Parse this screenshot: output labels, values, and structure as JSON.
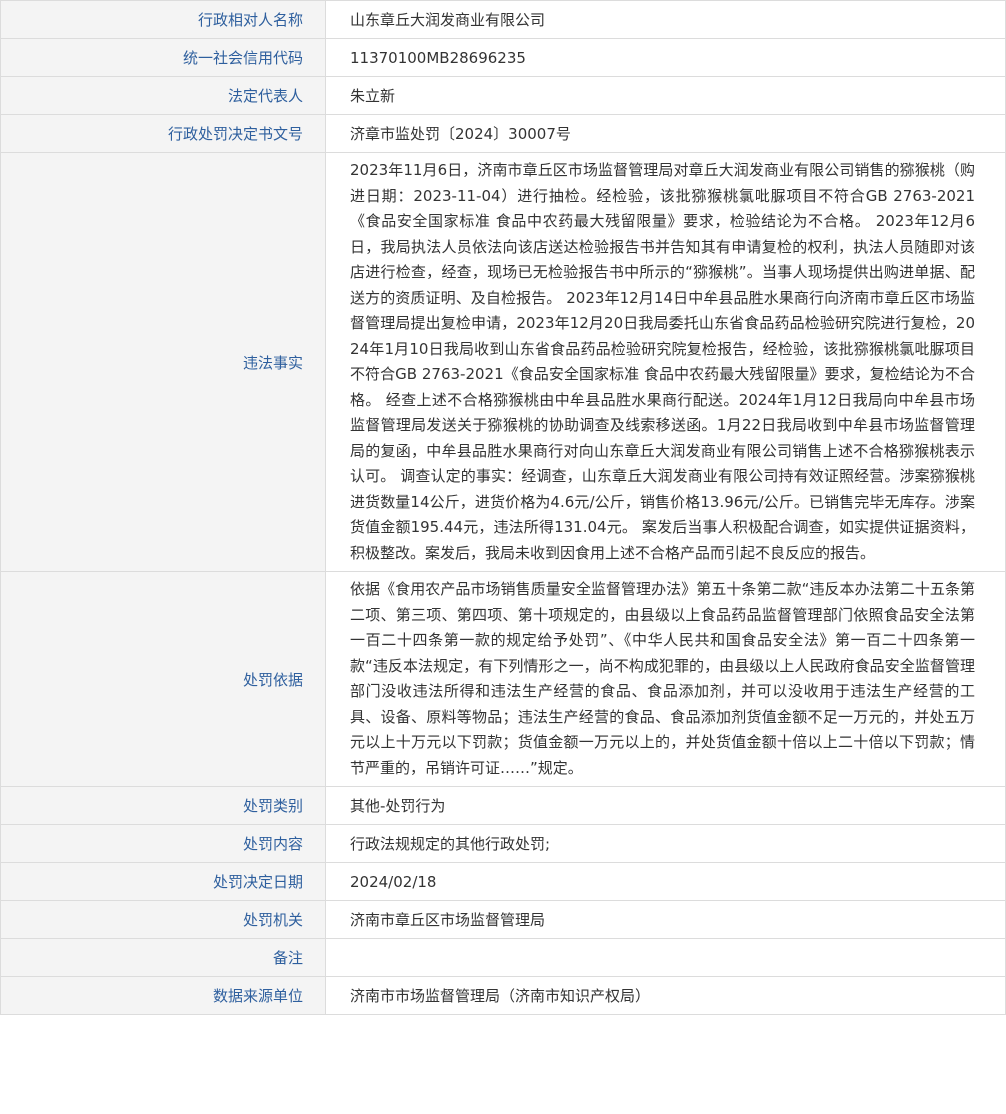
{
  "rows": [
    {
      "label": "行政相对人名称",
      "value": "山东章丘大润发商业有限公司"
    },
    {
      "label": "统一社会信用代码",
      "value": "11370100MB28696235"
    },
    {
      "label": "法定代表人",
      "value": "朱立新"
    },
    {
      "label": "行政处罚决定书文号",
      "value": "济章市监处罚〔2024〕30007号"
    },
    {
      "label": "违法事实",
      "value": "2023年11月6日，济南市章丘区市场监督管理局对章丘大润发商业有限公司销售的猕猴桃（购进日期：2023-11-04）进行抽检。经检验，该批猕猴桃氯吡脲项目不符合GB 2763-2021《食品安全国家标准 食品中农药最大残留限量》要求，检验结论为不合格。 2023年12月6日，我局执法人员依法向该店送达检验报告书并告知其有申请复检的权利，执法人员随即对该店进行检查，经查，现场已无检验报告书中所示的“猕猴桃”。当事人现场提供出购进单据、配送方的资质证明、及自检报告。 2023年12月14日中牟县品胜水果商行向济南市章丘区市场监督管理局提出复检申请，2023年12月20日我局委托山东省食品药品检验研究院进行复检，2024年1月10日我局收到山东省食品药品检验研究院复检报告，经检验，该批猕猴桃氯吡脲项目不符合GB 2763-2021《食品安全国家标准 食品中农药最大残留限量》要求，复检结论为不合格。 经查上述不合格猕猴桃由中牟县品胜水果商行配送。2024年1月12日我局向中牟县市场监督管理局发送关于猕猴桃的协助调查及线索移送函。1月22日我局收到中牟县市场监督管理局的复函，中牟县品胜水果商行对向山东章丘大润发商业有限公司销售上述不合格猕猴桃表示认可。 调查认定的事实：经调查，山东章丘大润发商业有限公司持有效证照经营。涉案猕猴桃进货数量14公斤，进货价格为4.6元/公斤，销售价格13.96元/公斤。已销售完毕无库存。涉案货值金额195.44元，违法所得131.04元。 案发后当事人积极配合调查，如实提供证据资料，积极整改。案发后，我局未收到因食用上述不合格产品而引起不良反应的报告。"
    },
    {
      "label": "处罚依据",
      "value": "依据《食用农产品市场销售质量安全监督管理办法》第五十条第二款“违反本办法第二十五条第二项、第三项、第四项、第十项规定的，由县级以上食品药品监督管理部门依照食品安全法第一百二十四条第一款的规定给予处罚”、《中华人民共和国食品安全法》第一百二十四条第一款“违反本法规定，有下列情形之一，尚不构成犯罪的，由县级以上人民政府食品安全监督管理部门没收违法所得和违法生产经营的食品、食品添加剂，并可以没收用于违法生产经营的工具、设备、原料等物品；违法生产经营的食品、食品添加剂货值金额不足一万元的，并处五万元以上十万元以下罚款；货值金额一万元以上的，并处货值金额十倍以上二十倍以下罚款；情节严重的，吊销许可证……”规定。"
    },
    {
      "label": "处罚类别",
      "value": "其他-处罚行为"
    },
    {
      "label": "处罚内容",
      "value": "行政法规规定的其他行政处罚;"
    },
    {
      "label": "处罚决定日期",
      "value": "2024/02/18"
    },
    {
      "label": "处罚机关",
      "value": "济南市章丘区市场监督管理局"
    },
    {
      "label": "备注",
      "value": ""
    },
    {
      "label": "数据来源单位",
      "value": "济南市市场监督管理局（济南市知识产权局）"
    }
  ],
  "colors": {
    "label_text": "#2e5f9e",
    "label_bg": "#f4f4f4",
    "border": "#dcdcdc",
    "value_text": "#333333"
  }
}
